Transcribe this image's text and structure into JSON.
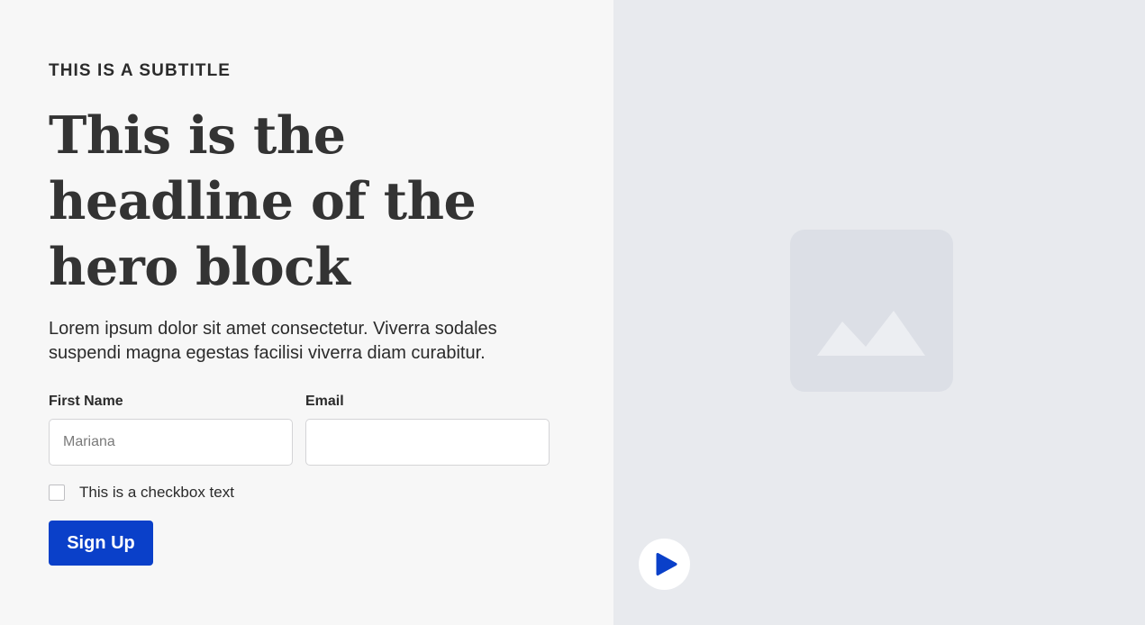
{
  "hero": {
    "subtitle": "THIS IS A SUBTITLE",
    "headline_lines": [
      "This is the",
      "headline of the",
      "hero block"
    ],
    "body": "Lorem ipsum dolor sit amet consectetur. Viverra sodales suspendi magna egestas facilisi viverra diam curabitur."
  },
  "form": {
    "first_name": {
      "label": "First Name",
      "placeholder": "Mariana",
      "value": ""
    },
    "email": {
      "label": "Email",
      "placeholder": "",
      "value": ""
    },
    "checkbox": {
      "label": "This is a checkbox text",
      "checked": false
    },
    "submit_label": "Sign Up"
  },
  "media": {
    "image_icon": "image-placeholder-icon",
    "play_icon": "play-icon"
  },
  "colors": {
    "accent": "#0a40c9",
    "left_bg": "#f7f7f7",
    "right_bg": "#e8eaee",
    "placeholder_bg": "#dcdfe6"
  }
}
